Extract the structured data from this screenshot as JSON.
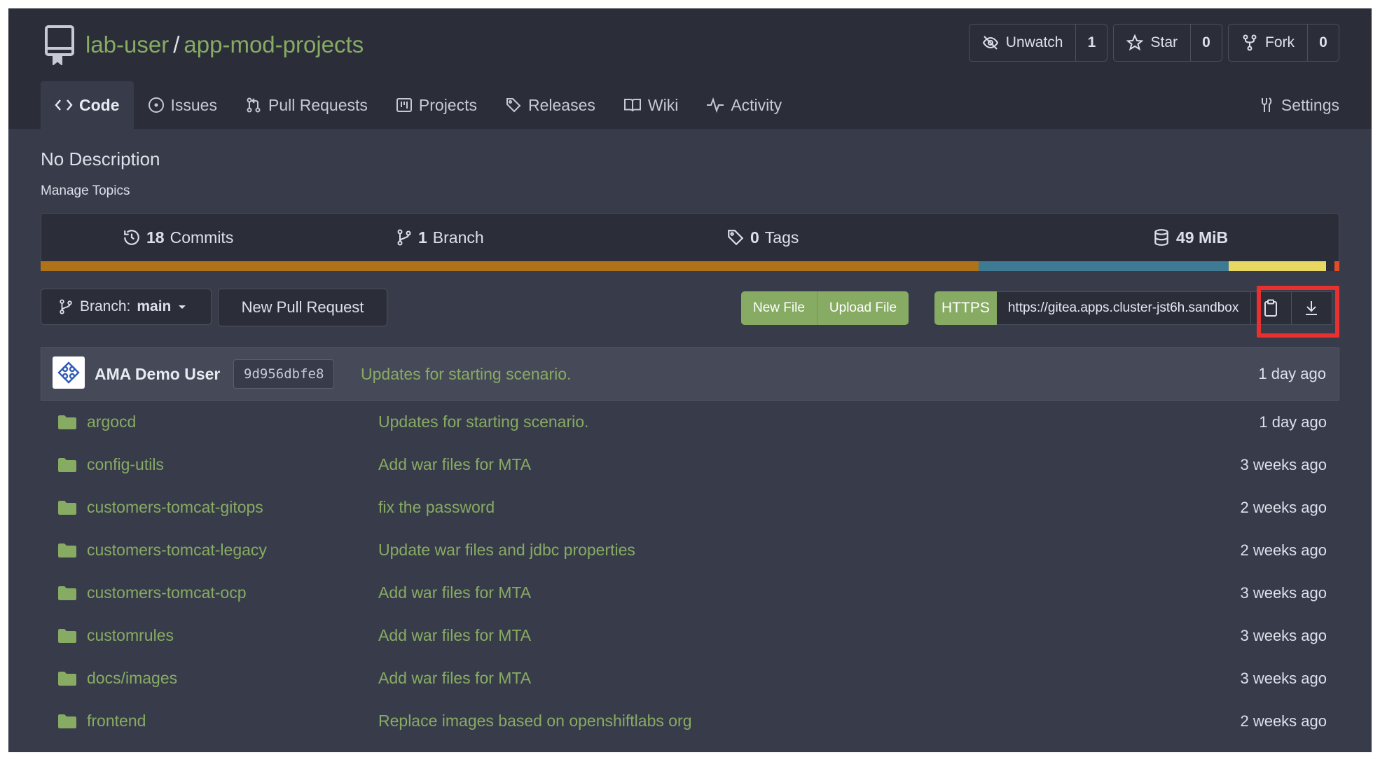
{
  "repo": {
    "owner": "lab-user",
    "separator": "/",
    "name": "app-mod-projects"
  },
  "actions": {
    "watch": {
      "label": "Unwatch",
      "count": "1"
    },
    "star": {
      "label": "Star",
      "count": "0"
    },
    "fork": {
      "label": "Fork",
      "count": "0"
    }
  },
  "tabs": [
    {
      "label": "Code",
      "icon": "code-icon"
    },
    {
      "label": "Issues",
      "icon": "issue-icon"
    },
    {
      "label": "Pull Requests",
      "icon": "pull-request-icon"
    },
    {
      "label": "Projects",
      "icon": "project-icon"
    },
    {
      "label": "Releases",
      "icon": "tag-icon"
    },
    {
      "label": "Wiki",
      "icon": "book-icon"
    },
    {
      "label": "Activity",
      "icon": "pulse-icon"
    }
  ],
  "settings": {
    "label": "Settings"
  },
  "description": "No Description",
  "manage_topics": "Manage Topics",
  "stats": {
    "commits": {
      "count": "18",
      "label": "Commits"
    },
    "branches": {
      "count": "1",
      "label": "Branch"
    },
    "tags": {
      "count": "0",
      "label": "Tags"
    },
    "size": {
      "value": "49 MiB"
    }
  },
  "languages": [
    {
      "color": "#b07219",
      "fraction": 0.722
    },
    {
      "color": "#3e7a93",
      "fraction": 0.193
    },
    {
      "color": "#e8d760",
      "fraction": 0.075
    },
    {
      "color": "#2b2e39",
      "fraction": 0.006
    },
    {
      "color": "#e34c26",
      "fraction": 0.004
    }
  ],
  "toolbar": {
    "branch_prefix": "Branch:",
    "branch_name": "main",
    "new_pull_request": "New Pull Request",
    "new_file": "New File",
    "upload_file": "Upload File",
    "protocol": "HTTPS",
    "clone_url": "https://gitea.apps.cluster-jst6h.sandbox"
  },
  "last_commit": {
    "author": "AMA Demo User",
    "sha": "9d956dbfe8",
    "message": "Updates for starting scenario.",
    "time": "1 day ago"
  },
  "files": [
    {
      "name": "argocd",
      "message": "Updates for starting scenario.",
      "time": "1 day ago"
    },
    {
      "name": "config-utils",
      "message": "Add war files for MTA",
      "time": "3 weeks ago"
    },
    {
      "name": "customers-tomcat-gitops",
      "message": "fix the password",
      "time": "2 weeks ago"
    },
    {
      "name": "customers-tomcat-legacy",
      "message": "Update war files and jdbc properties",
      "time": "2 weeks ago"
    },
    {
      "name": "customers-tomcat-ocp",
      "message": "Add war files for MTA",
      "time": "3 weeks ago"
    },
    {
      "name": "customrules",
      "message": "Add war files for MTA",
      "time": "3 weeks ago"
    },
    {
      "name": "docs/images",
      "message": "Add war files for MTA",
      "time": "3 weeks ago"
    },
    {
      "name": "frontend",
      "message": "Replace images based on openshiftlabs org",
      "time": "2 weeks ago"
    }
  ]
}
